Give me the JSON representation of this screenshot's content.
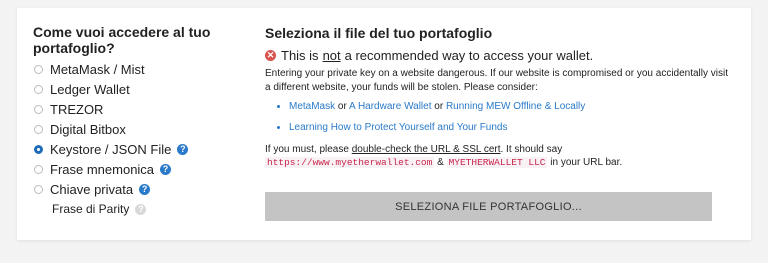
{
  "access": {
    "heading": "Come vuoi accedere al tuo portafoglio?",
    "options": [
      {
        "label": "MetaMask / Mist"
      },
      {
        "label": "Ledger Wallet"
      },
      {
        "label": "TREZOR"
      },
      {
        "label": "Digital Bitbox"
      },
      {
        "label": "Keystore / JSON File"
      },
      {
        "label": "Frase mnemonica"
      },
      {
        "label": "Chiave privata"
      }
    ],
    "sub_option": "Frase di Parity",
    "selected": "Keystore / JSON File"
  },
  "file_panel": {
    "heading": "Seleziona il file del tuo portafoglio",
    "warning_pre": "This is",
    "warning_not": "not",
    "warning_post": "a recommended way to access your wallet.",
    "paragraph": "Entering your private key on a website dangerous. If our website is compromised or you accidentally visit a different website, your funds will be stolen. Please consider:",
    "link_metamask": "MetaMask",
    "or_1": "or",
    "link_hardware": "A Hardware Wallet",
    "or_2": "or",
    "link_mew": "Running MEW Offline & Locally",
    "link_learning": "Learning How to Protect Yourself and Your Funds",
    "must_pre": "If you must, please",
    "must_link": "double-check the URL & SSL cert",
    "must_post": ". It should say",
    "url": "https://www.myetherwallet.com",
    "amp": "&",
    "cert": "MYETHERWALLET LLC",
    "url_bar": "in your URL bar.",
    "button": "SELEZIONA FILE PORTAFOGLIO..."
  },
  "colors": {
    "accent": "#2a7ac9",
    "error": "#d9534f",
    "code": "#c7254e",
    "button_bg": "#c4c4c4"
  }
}
